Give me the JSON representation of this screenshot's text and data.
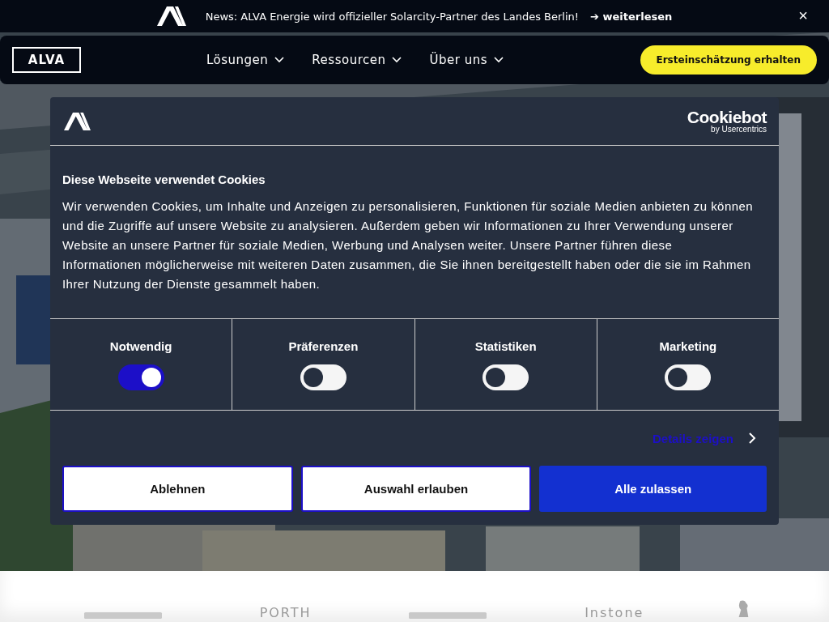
{
  "news_bar": {
    "text": "News: ALVA Energie wird offizieller Solarcity-Partner des Landes Berlin!",
    "link": "➔ weiterlesen",
    "close": "×"
  },
  "nav": {
    "logo": "ALVA",
    "menu": [
      {
        "label": "Lösungen"
      },
      {
        "label": "Ressourcen"
      },
      {
        "label": "Über uns"
      }
    ],
    "cta": "Ersteinschätzung erhalten"
  },
  "cookie_dialog": {
    "brand": {
      "name": "Cookiebot",
      "byline": "by Usercentrics"
    },
    "title": "Diese Webseite verwendet Cookies",
    "body": "Wir verwenden Cookies, um Inhalte und Anzeigen zu personalisieren, Funktionen für soziale Medien anbieten zu können und die Zugriffe auf unsere Website zu analysieren. Außerdem geben wir Informationen zu Ihrer Verwendung unserer Website an unsere Partner für soziale Medien, Werbung und Analysen weiter. Unsere Partner führen diese Informationen möglicherweise mit weiteren Daten zusammen, die Sie ihnen bereitgestellt haben oder die sie im Rahmen Ihrer Nutzung der Dienste gesammelt haben.",
    "categories": [
      {
        "label": "Notwendig",
        "on": true
      },
      {
        "label": "Präferenzen",
        "on": false
      },
      {
        "label": "Statistiken",
        "on": false
      },
      {
        "label": "Marketing",
        "on": false
      }
    ],
    "details_link": "Details zeigen",
    "buttons": [
      {
        "label": "Ablehnen",
        "kind": "outline"
      },
      {
        "label": "Auswahl erlauben",
        "kind": "outline"
      },
      {
        "label": "Alle zulassen",
        "kind": "primary"
      }
    ]
  },
  "partner_logos": [
    {
      "kind": "mark"
    },
    {
      "kind": "text",
      "label": "PORTH"
    },
    {
      "kind": "mark"
    },
    {
      "kind": "text",
      "label": "Instone"
    },
    {
      "kind": "lion"
    }
  ]
}
